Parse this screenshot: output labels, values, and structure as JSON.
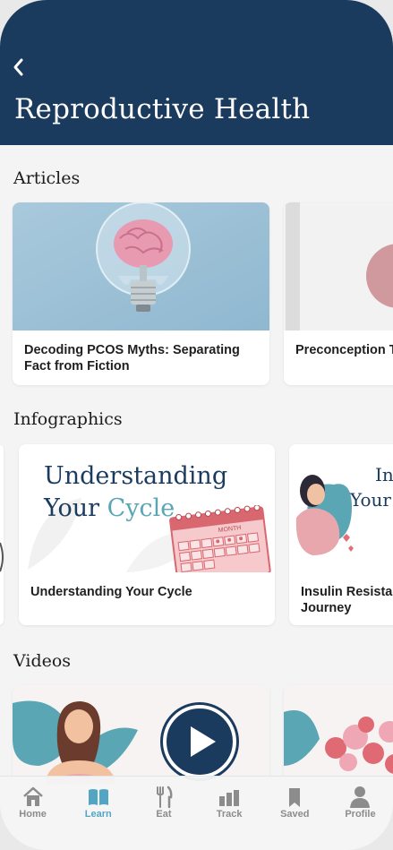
{
  "header": {
    "title": "Reproductive Health"
  },
  "sections": {
    "articles": {
      "title": "Articles",
      "items": [
        {
          "title": "Decoding PCOS Myths: Separating Fact from Fiction"
        },
        {
          "title": "Preconception Trying to Conce"
        }
      ]
    },
    "infographics": {
      "title": "Infographics",
      "items": [
        {
          "title": "Understanding Your Cycle",
          "art_line1": "Understanding",
          "art_line2a": "Your",
          "art_line2b": "Cycle",
          "calendar_label": "MONTH"
        },
        {
          "title": "Insulin Resista Journey",
          "art_line1": "In",
          "art_line2": "Your"
        }
      ]
    },
    "videos": {
      "title": "Videos"
    }
  },
  "tabbar": {
    "active": "Learn",
    "items": [
      {
        "label": "Home",
        "icon": "home-icon"
      },
      {
        "label": "Learn",
        "icon": "book-icon"
      },
      {
        "label": "Eat",
        "icon": "fork-knife-icon"
      },
      {
        "label": "Track",
        "icon": "bar-chart-icon"
      },
      {
        "label": "Saved",
        "icon": "bookmark-icon"
      },
      {
        "label": "Profile",
        "icon": "person-icon"
      }
    ]
  },
  "colors": {
    "header": "#1b3b5e",
    "accent": "#53a6c3",
    "teal": "#5aa6b4",
    "pink": "#e8a6ad"
  }
}
